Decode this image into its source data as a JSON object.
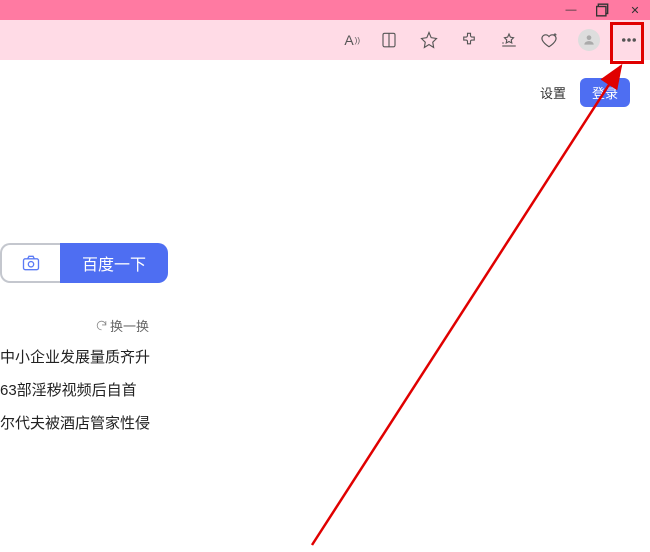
{
  "window": {
    "minimize": "—",
    "maximize": "▢",
    "close": "✕"
  },
  "toolbar": {
    "font_label": "A",
    "font_sup": "))"
  },
  "page": {
    "settings": "设置",
    "login": "登录"
  },
  "search": {
    "button": "百度一下"
  },
  "refresh": "换一换",
  "news": [
    "中小企业发展量质齐升",
    "63部淫秽视频后自首",
    "尔代夫被酒店管家性侵"
  ],
  "colors": {
    "accent": "#4e6ef2",
    "annotation": "#e00000",
    "titlebar": "#ff7aa2",
    "addressbar": "#ffdbe6"
  }
}
